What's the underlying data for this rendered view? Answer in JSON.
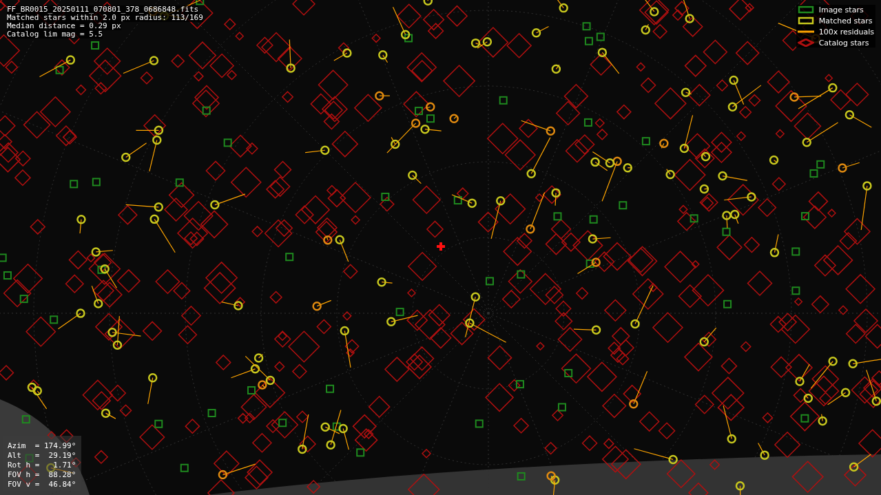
{
  "info": {
    "lines": [
      "FF_BR0015_20250111_070801_378_0686848.fits",
      "Matched stars within 2.0 px radius: 113/169",
      "Median distance = 0.29 px",
      "Catalog lim mag = 5.5"
    ]
  },
  "legend": [
    {
      "kind": "image",
      "label": "Image stars",
      "color": "#1f8a1f"
    },
    {
      "kind": "matched",
      "label": "Matched stars",
      "color": "#c8c81e"
    },
    {
      "kind": "residual",
      "label": "100x residuals",
      "color": "#ffa500"
    },
    {
      "kind": "catalog",
      "label": "Catalog stars",
      "color": "#b01010"
    }
  ],
  "pointing": {
    "lines": [
      "Azim  = 174.99°",
      "Alt   =  29.19°",
      "Rot h =   1.71°",
      "FOV h =  88.28°",
      "FOV v =  46.84°"
    ]
  }
}
